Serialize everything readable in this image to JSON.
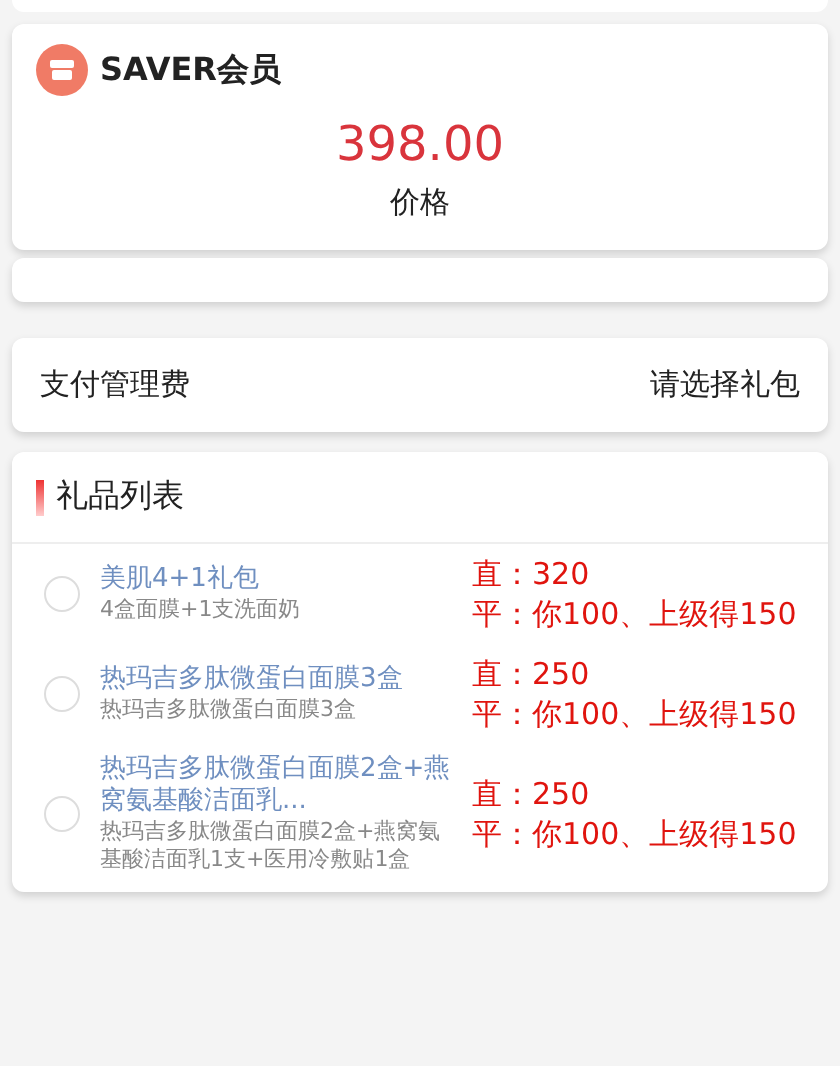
{
  "member": {
    "title": "SAVER会员",
    "price": "398.00",
    "price_label": "价格"
  },
  "fee_row": {
    "label": "支付管理费",
    "value": "请选择礼包"
  },
  "gift_list": {
    "title": "礼品列表",
    "items": [
      {
        "title": "美肌4+1礼包",
        "desc": "4盒面膜+1支洗面奶",
        "selected": false,
        "notes": [
          "直：320",
          "平：你100、上级得150"
        ]
      },
      {
        "title": "热玛吉多肽微蛋白面膜3盒",
        "desc": "热玛吉多肽微蛋白面膜3盒",
        "selected": false,
        "notes": [
          "直：250",
          "平：你100、上级得150"
        ]
      },
      {
        "title": "热玛吉多肽微蛋白面膜2盒+燕窝氨基酸洁面乳...",
        "desc": "热玛吉多肽微蛋白面膜2盒+燕窝氨基酸洁面乳1支+医用冷敷贴1盒",
        "selected": false,
        "notes": [
          "直：250",
          "平：你100、上级得150"
        ]
      }
    ]
  }
}
